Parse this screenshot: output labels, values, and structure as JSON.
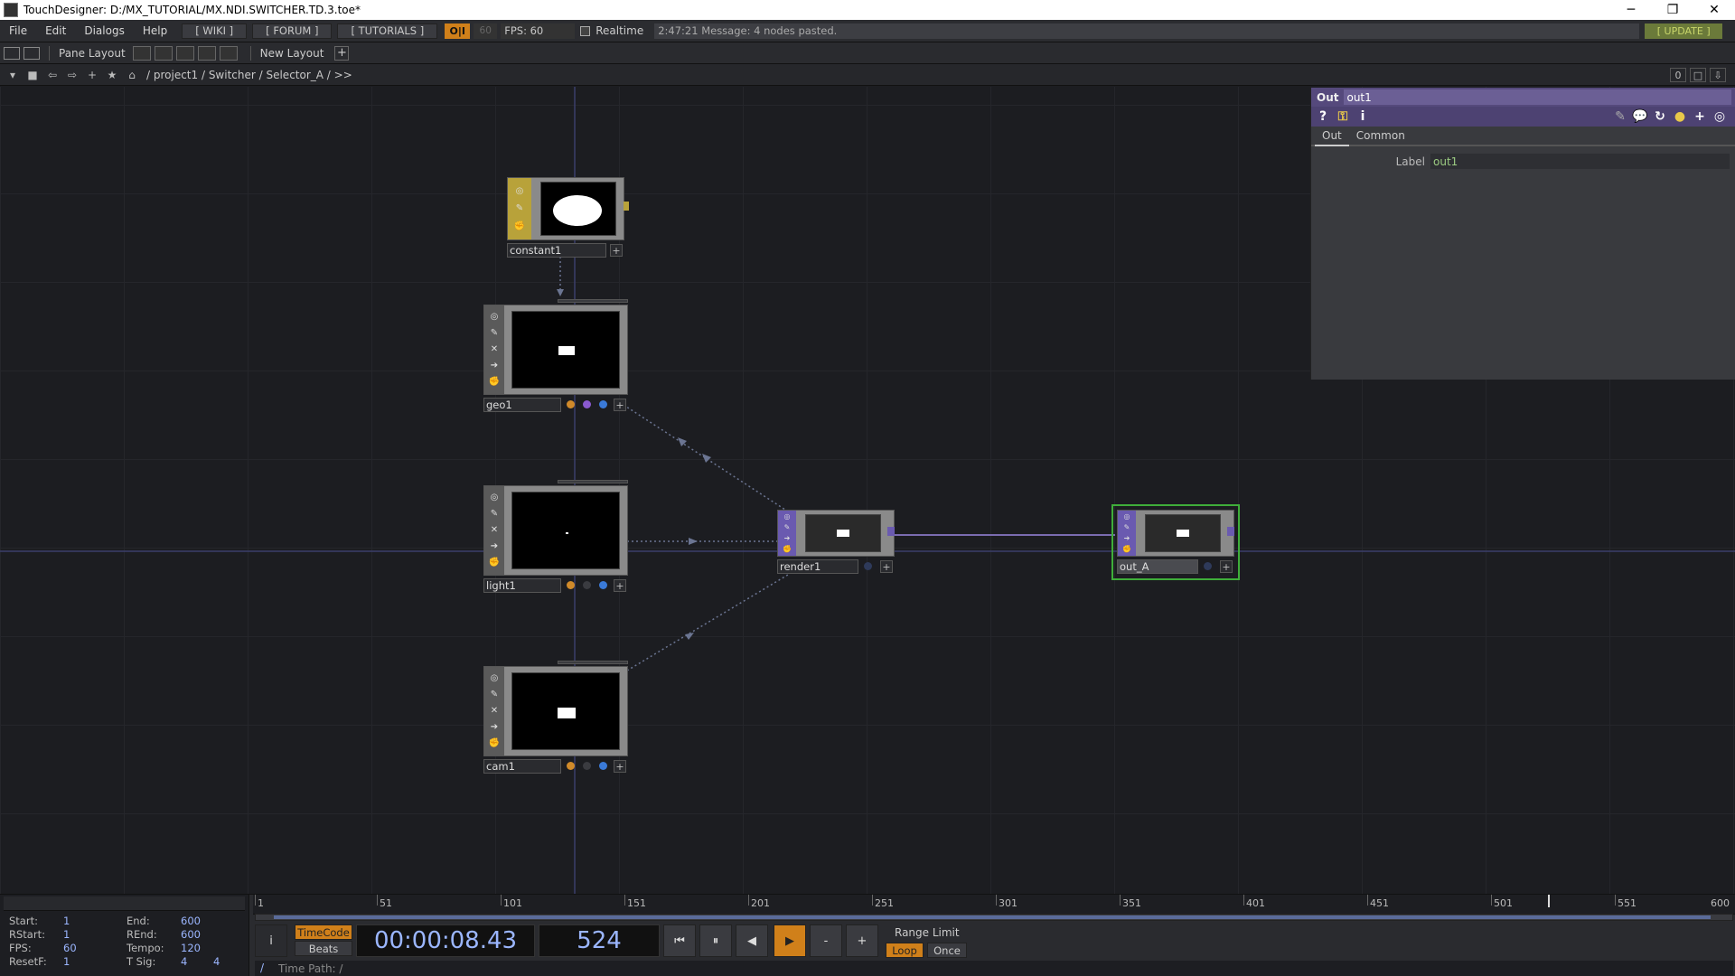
{
  "window": {
    "title": "TouchDesigner: D:/MX_TUTORIAL/MX.NDI.SWITCHER.TD.3.toe*",
    "minimize": "─",
    "restore": "❐",
    "close": "✕"
  },
  "menubar": {
    "items": [
      "File",
      "Edit",
      "Dialogs",
      "Help"
    ],
    "links": [
      "[ WIKI ]",
      "[ FORUM ]",
      "[ TUTORIALS ]"
    ],
    "oi_label": "O|I",
    "fps_box": "60",
    "fps_text": "FPS:  60",
    "realtime_label": "Realtime",
    "message": "2:47:21 Message: 4 nodes pasted.",
    "update_label": "[ UPDATE ]"
  },
  "panebar": {
    "pane_layout_label": "Pane Layout",
    "new_layout_label": "New Layout",
    "plus": "+"
  },
  "pathbar": {
    "path": "/ project1 / Switcher / Selector_A / >>",
    "zero_label": "0"
  },
  "nodes": {
    "constant1": {
      "label": "constant1"
    },
    "geo1": {
      "label": "geo1"
    },
    "light1": {
      "label": "light1"
    },
    "cam1": {
      "label": "cam1"
    },
    "render1": {
      "label": "render1"
    },
    "out_A": {
      "label": "out_A"
    }
  },
  "params": {
    "op_type": "Out",
    "op_name": "out1",
    "tabs": [
      "Out",
      "Common"
    ],
    "label_param": "Label",
    "label_value": "out1"
  },
  "timeline": {
    "info": {
      "start_label": "Start:",
      "start": "1",
      "end_label": "End:",
      "end": "600",
      "rstart_label": "RStart:",
      "rstart": "1",
      "rend_label": "REnd:",
      "rend": "600",
      "fps_label": "FPS:",
      "fps": "60",
      "tempo_label": "Tempo:",
      "tempo": "120",
      "resetf_label": "ResetF:",
      "resetf": "1",
      "tsig_label": "T Sig:",
      "tsig_a": "4",
      "tsig_b": "4"
    },
    "ruler_labels": [
      "1",
      "51",
      "101",
      "151",
      "201",
      "251",
      "301",
      "351",
      "401",
      "451",
      "501",
      "551",
      "600"
    ],
    "timecode_label": "TimeCode",
    "beats_label": "Beats",
    "timecode": "00:00:08.43",
    "frame": "524",
    "range_limit_label": "Range Limit",
    "loop_label": "Loop",
    "once_label": "Once",
    "minus": "-",
    "plus": "+",
    "time_path": "Time Path: /",
    "slash": "/",
    "info_btn": "i"
  }
}
